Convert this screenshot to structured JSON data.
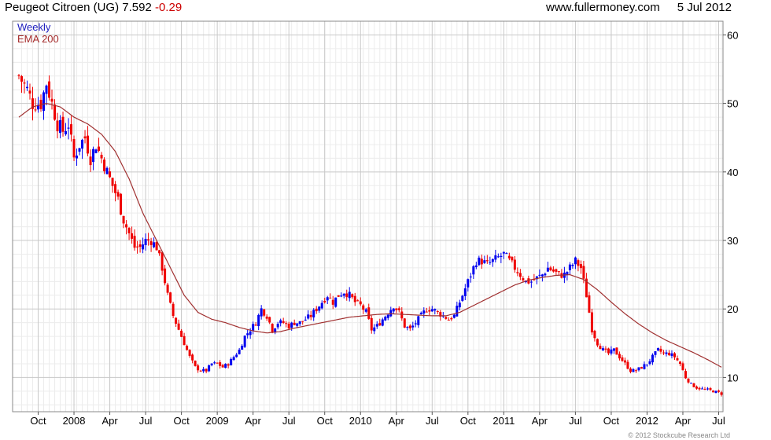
{
  "header": {
    "instrument": "Peugeot Citroen (UG)",
    "last": "7.592",
    "change": "-0.29",
    "source": "www.fullermoney.com",
    "date": "5 Jul 2012"
  },
  "copyright": "© 2012 Stockcube Research Ltd",
  "chart_data": {
    "type": "candlestick",
    "title": "Peugeot Citroen (UG) 7.592 -0.29",
    "ylim": [
      5,
      62
    ],
    "y_ticks": [
      10,
      20,
      30,
      40,
      50,
      60
    ],
    "grid": true,
    "legend_position": "top-left",
    "colors": {
      "up": "#0000ee",
      "down": "#ee0000",
      "ema": "#a03030",
      "grid": "#c8c8c8"
    },
    "x_ticks": [
      {
        "label": "Oct",
        "week": 7
      },
      {
        "label": "2008",
        "week": 20
      },
      {
        "label": "Apr",
        "week": 33
      },
      {
        "label": "Jul",
        "week": 46
      },
      {
        "label": "Oct",
        "week": 59
      },
      {
        "label": "2009",
        "week": 72
      },
      {
        "label": "Apr",
        "week": 85
      },
      {
        "label": "Jul",
        "week": 98
      },
      {
        "label": "Oct",
        "week": 111
      },
      {
        "label": "2010",
        "week": 124
      },
      {
        "label": "Apr",
        "week": 137
      },
      {
        "label": "Jul",
        "week": 150
      },
      {
        "label": "Oct",
        "week": 163
      },
      {
        "label": "2011",
        "week": 176
      },
      {
        "label": "Apr",
        "week": 189
      },
      {
        "label": "Jul",
        "week": 202
      },
      {
        "label": "Oct",
        "week": 215
      },
      {
        "label": "2012",
        "week": 228
      },
      {
        "label": "Apr",
        "week": 241
      },
      {
        "label": "Jul",
        "week": 254
      }
    ],
    "series": [
      {
        "name": "Weekly",
        "kind": "close",
        "points": [
          [
            0,
            54
          ],
          [
            3,
            52
          ],
          [
            5,
            50
          ],
          [
            8,
            50
          ],
          [
            10,
            53
          ],
          [
            12,
            50
          ],
          [
            14,
            47
          ],
          [
            16,
            46
          ],
          [
            18,
            47
          ],
          [
            20,
            42
          ],
          [
            22,
            44
          ],
          [
            24,
            45
          ],
          [
            26,
            42
          ],
          [
            28,
            44
          ],
          [
            30,
            42
          ],
          [
            32,
            40
          ],
          [
            34,
            38
          ],
          [
            36,
            36
          ],
          [
            38,
            33
          ],
          [
            40,
            31
          ],
          [
            42,
            29
          ],
          [
            44,
            29
          ],
          [
            46,
            30
          ],
          [
            48,
            30
          ],
          [
            50,
            29
          ],
          [
            52,
            26
          ],
          [
            54,
            22
          ],
          [
            56,
            19
          ],
          [
            58,
            17
          ],
          [
            60,
            15
          ],
          [
            62,
            13
          ],
          [
            64,
            11.5
          ],
          [
            66,
            11
          ],
          [
            68,
            11
          ],
          [
            70,
            12
          ],
          [
            72,
            12
          ],
          [
            74,
            11.5
          ],
          [
            76,
            12
          ],
          [
            78,
            13
          ],
          [
            80,
            14
          ],
          [
            82,
            16
          ],
          [
            84,
            17
          ],
          [
            86,
            18
          ],
          [
            88,
            20
          ],
          [
            90,
            19
          ],
          [
            92,
            17
          ],
          [
            94,
            18
          ],
          [
            96,
            18
          ],
          [
            98,
            17.5
          ],
          [
            100,
            18
          ],
          [
            102,
            18
          ],
          [
            104,
            18.5
          ],
          [
            106,
            19
          ],
          [
            108,
            20
          ],
          [
            110,
            21
          ],
          [
            112,
            22
          ],
          [
            114,
            21
          ],
          [
            116,
            22
          ],
          [
            118,
            22.5
          ],
          [
            120,
            22
          ],
          [
            122,
            21
          ],
          [
            124,
            20.5
          ],
          [
            126,
            19.5
          ],
          [
            128,
            17
          ],
          [
            130,
            17.5
          ],
          [
            132,
            18.5
          ],
          [
            134,
            19.5
          ],
          [
            136,
            20.5
          ],
          [
            138,
            19.5
          ],
          [
            140,
            17.5
          ],
          [
            142,
            17
          ],
          [
            144,
            18
          ],
          [
            146,
            19
          ],
          [
            148,
            20
          ],
          [
            150,
            20
          ],
          [
            152,
            19.5
          ],
          [
            154,
            19
          ],
          [
            156,
            18.5
          ],
          [
            158,
            19
          ],
          [
            160,
            21
          ],
          [
            162,
            23
          ],
          [
            164,
            25
          ],
          [
            166,
            27
          ],
          [
            168,
            27
          ],
          [
            170,
            26.5
          ],
          [
            172,
            27
          ],
          [
            174,
            27.5
          ],
          [
            176,
            28
          ],
          [
            178,
            27
          ],
          [
            180,
            26
          ],
          [
            182,
            25
          ],
          [
            184,
            24
          ],
          [
            186,
            24
          ],
          [
            188,
            24.5
          ],
          [
            190,
            25
          ],
          [
            192,
            26
          ],
          [
            194,
            25.5
          ],
          [
            196,
            25
          ],
          [
            198,
            25
          ],
          [
            200,
            26
          ],
          [
            202,
            27
          ],
          [
            204,
            26
          ],
          [
            206,
            22
          ],
          [
            208,
            17
          ],
          [
            210,
            15
          ],
          [
            212,
            14
          ],
          [
            214,
            13.5
          ],
          [
            216,
            14
          ],
          [
            218,
            13
          ],
          [
            220,
            12
          ],
          [
            222,
            11
          ],
          [
            224,
            11
          ],
          [
            226,
            11.5
          ],
          [
            228,
            12
          ],
          [
            230,
            13
          ],
          [
            232,
            14
          ],
          [
            234,
            13.5
          ],
          [
            236,
            13.5
          ],
          [
            238,
            13
          ],
          [
            240,
            12
          ],
          [
            242,
            10
          ],
          [
            244,
            9
          ],
          [
            246,
            8.5
          ],
          [
            248,
            8.3
          ],
          [
            250,
            8.2
          ],
          [
            252,
            8
          ],
          [
            254,
            7.8
          ],
          [
            255,
            7.6
          ]
        ]
      },
      {
        "name": "EMA 200",
        "kind": "line",
        "points": [
          [
            0,
            48
          ],
          [
            5,
            49.5
          ],
          [
            10,
            50
          ],
          [
            15,
            49.5
          ],
          [
            20,
            48
          ],
          [
            25,
            47
          ],
          [
            30,
            45.5
          ],
          [
            35,
            43
          ],
          [
            40,
            39
          ],
          [
            45,
            34
          ],
          [
            50,
            30
          ],
          [
            55,
            26
          ],
          [
            60,
            22
          ],
          [
            65,
            19.5
          ],
          [
            70,
            18.5
          ],
          [
            75,
            18
          ],
          [
            80,
            17.3
          ],
          [
            85,
            16.8
          ],
          [
            90,
            16.5
          ],
          [
            95,
            16.7
          ],
          [
            100,
            17.2
          ],
          [
            105,
            17.6
          ],
          [
            110,
            18
          ],
          [
            115,
            18.4
          ],
          [
            120,
            18.8
          ],
          [
            125,
            19
          ],
          [
            130,
            19.2
          ],
          [
            135,
            19.3
          ],
          [
            140,
            19.2
          ],
          [
            145,
            19.1
          ],
          [
            150,
            19
          ],
          [
            155,
            19
          ],
          [
            160,
            19.5
          ],
          [
            165,
            20.5
          ],
          [
            170,
            21.5
          ],
          [
            175,
            22.5
          ],
          [
            180,
            23.5
          ],
          [
            185,
            24.2
          ],
          [
            190,
            24.6
          ],
          [
            195,
            24.9
          ],
          [
            200,
            25
          ],
          [
            205,
            24.3
          ],
          [
            210,
            22.8
          ],
          [
            215,
            21
          ],
          [
            220,
            19.3
          ],
          [
            225,
            17.8
          ],
          [
            230,
            16.5
          ],
          [
            235,
            15.4
          ],
          [
            240,
            14.5
          ],
          [
            245,
            13.6
          ],
          [
            250,
            12.6
          ],
          [
            255,
            11.5
          ]
        ]
      }
    ]
  }
}
